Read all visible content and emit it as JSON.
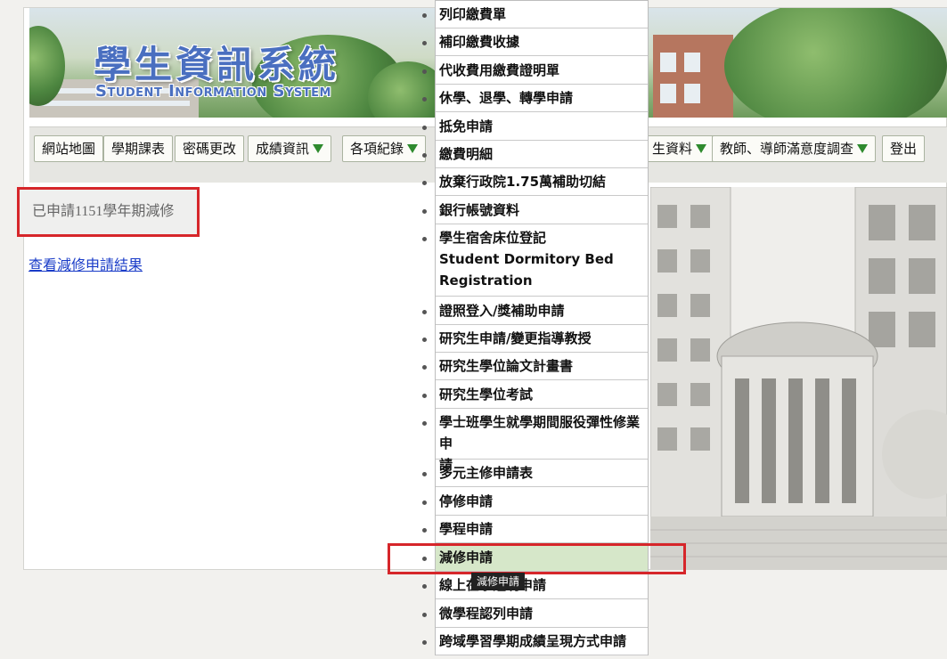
{
  "banner": {
    "title_cn": "學生資訊系統",
    "title_en": "Student Information System"
  },
  "nav": [
    {
      "label": "網站地圖",
      "has_dropdown": false
    },
    {
      "label": "學期課表",
      "has_dropdown": false
    },
    {
      "label": "密碼更改",
      "has_dropdown": false
    },
    {
      "label": "成績資訊",
      "has_dropdown": true
    },
    {
      "label": "各項紀錄",
      "has_dropdown": true
    },
    {
      "label": "生資料",
      "has_dropdown": true
    },
    {
      "label": "教師、導師滿意度調查",
      "has_dropdown": true
    },
    {
      "label": "登出",
      "has_dropdown": false
    }
  ],
  "main": {
    "message": "已申請1151學年期減修",
    "link": "查看減修申請結果"
  },
  "dropdown": {
    "items": [
      "列印繳費單",
      "補印繳費收據",
      "代收費用繳費證明單",
      "休學、退學、轉學申請",
      "抵免申請",
      "繳費明細",
      "放棄行政院1.75萬補助切結",
      "銀行帳號資料",
      "學生宿舍床位登記\nStudent Dormitory Bed\nRegistration",
      "證照登入/獎補助申請",
      "研究生申請/變更指導教授",
      "研究生學位論文計畫書",
      "研究生學位考試",
      "學士班學生就學期間服役彈性修業申\n請",
      "多元主修申請表",
      "停修申請",
      "學程申請",
      "減修申請",
      "線上在學證明申請",
      "微學程認列申請",
      "跨域學習學期成績呈現方式申請"
    ],
    "active_index": 17,
    "tooltip": "減修申請"
  },
  "colors": {
    "highlight": "#d6262a",
    "active_item": "#d6e7c9",
    "dropdown_arrow": "#2e8a2e",
    "link": "#1a3cc8"
  }
}
